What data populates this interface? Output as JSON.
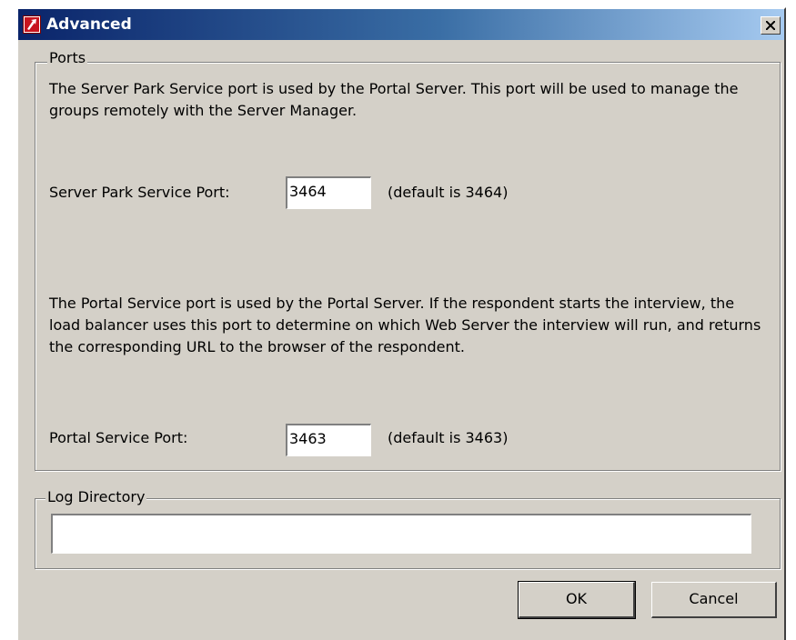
{
  "window": {
    "title": "Advanced"
  },
  "ports": {
    "legend": "Ports",
    "server_park_description": "The Server Park Service port is used by the Portal Server. This port will be used to manage the groups remotely with the Server Manager.",
    "server_park_label": "Server Park Service Port:",
    "server_park_value": "3464",
    "server_park_default": "(default is 3464)",
    "portal_description": "The Portal Service port is used by the Portal Server. If the respondent starts the interview, the load balancer uses this port to determine on which Web Server the interview will run, and returns the corresponding URL to the browser of the respondent.",
    "portal_label": "Portal Service Port:",
    "portal_value": "3463",
    "portal_default": "(default is 3463)"
  },
  "log": {
    "legend": "Log Directory",
    "value": ""
  },
  "buttons": {
    "ok": "OK",
    "cancel": "Cancel"
  },
  "icons": {
    "app": "app-logo-icon",
    "close": "close-icon"
  },
  "colors": {
    "titlebar_start": "#0a246a",
    "titlebar_end": "#a6caf0",
    "dialog_bg": "#d4d0c8"
  }
}
